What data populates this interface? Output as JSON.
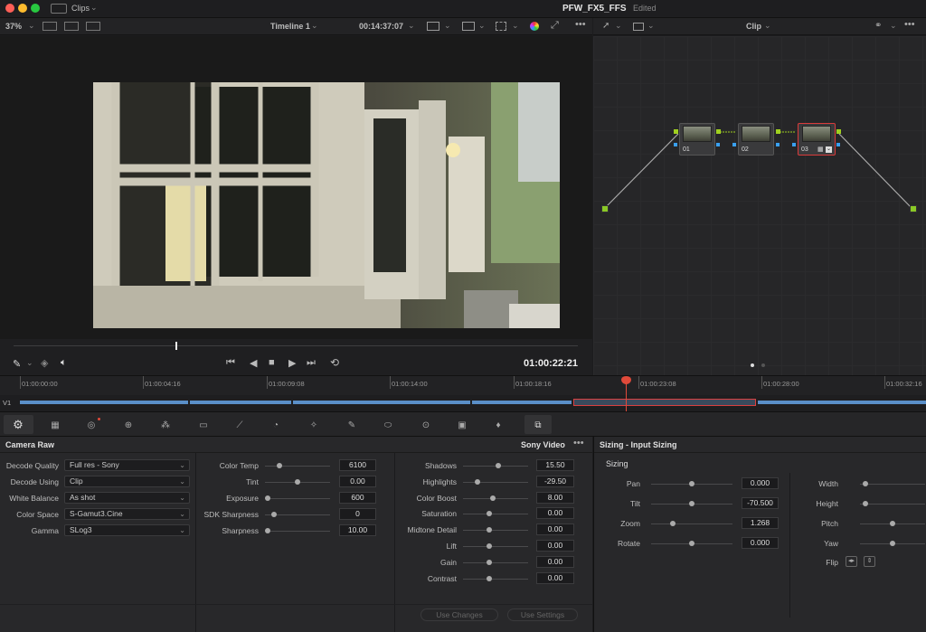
{
  "title_bar": {
    "clips_label": "Clips",
    "project_name": "PFW_FX5_FFS",
    "status": "Edited"
  },
  "viewer_bar": {
    "zoom": "37%",
    "timeline_name": "Timeline 1",
    "source_timecode": "00:14:37:07"
  },
  "node_bar": {
    "mode": "Clip"
  },
  "nodes": [
    {
      "label": "01"
    },
    {
      "label": "02"
    },
    {
      "label": "03"
    }
  ],
  "transport": {
    "timecode": "01:00:22:21"
  },
  "timeline": {
    "track_label": "V1",
    "ruler": [
      "01:00:00:00",
      "01:00:04:16",
      "01:00:09:08",
      "01:00:14:00",
      "01:00:18:16",
      "01:00:23:08",
      "01:00:28:00",
      "01:00:32:16"
    ]
  },
  "camera_raw": {
    "title": "Camera Raw",
    "format": "Sony Video",
    "dropdowns": [
      {
        "label": "Decode Quality",
        "value": "Full res - Sony"
      },
      {
        "label": "Decode Using",
        "value": "Clip"
      },
      {
        "label": "White Balance",
        "value": "As shot"
      },
      {
        "label": "Color Space",
        "value": "S-Gamut3.Cine"
      },
      {
        "label": "Gamma",
        "value": "SLog3"
      }
    ],
    "mid_params": [
      {
        "label": "Color Temp",
        "value": "6100",
        "level": 0.2
      },
      {
        "label": "Tint",
        "value": "0.00",
        "level": 0.5
      },
      {
        "label": "Exposure",
        "value": "600",
        "level": 0.0
      },
      {
        "label": "SDK Sharpness",
        "value": "0",
        "level": 0.1
      },
      {
        "label": "Sharpness",
        "value": "10.00",
        "level": 0.0
      }
    ],
    "right_params": [
      {
        "label": "Shadows",
        "value": "15.50",
        "level": 0.55
      },
      {
        "label": "Highlights",
        "value": "-29.50",
        "level": 0.2
      },
      {
        "label": "Color Boost",
        "value": "8.00",
        "level": 0.45
      },
      {
        "label": "Saturation",
        "value": "0.00",
        "level": 0.4
      },
      {
        "label": "Midtone Detail",
        "value": "0.00",
        "level": 0.4
      },
      {
        "label": "Lift",
        "value": "0.00",
        "level": 0.4
      },
      {
        "label": "Gain",
        "value": "0.00",
        "level": 0.4
      },
      {
        "label": "Contrast",
        "value": "0.00",
        "level": 0.4
      }
    ],
    "use_changes": "Use Changes",
    "use_settings": "Use Settings"
  },
  "sizing": {
    "title": "Sizing - Input Sizing",
    "section": "Sizing",
    "left_params": [
      {
        "label": "Pan",
        "value": "0.000",
        "level": 0.5
      },
      {
        "label": "Tilt",
        "value": "-70.500",
        "level": 0.5
      },
      {
        "label": "Zoom",
        "value": "1.268",
        "level": 0.25
      },
      {
        "label": "Rotate",
        "value": "0.000",
        "level": 0.5
      }
    ],
    "right_params": [
      {
        "label": "Width",
        "level": 0.05
      },
      {
        "label": "Height",
        "level": 0.05
      },
      {
        "label": "Pitch",
        "level": 0.5
      },
      {
        "label": "Yaw",
        "level": 0.5
      }
    ],
    "flip_label": "Flip"
  }
}
